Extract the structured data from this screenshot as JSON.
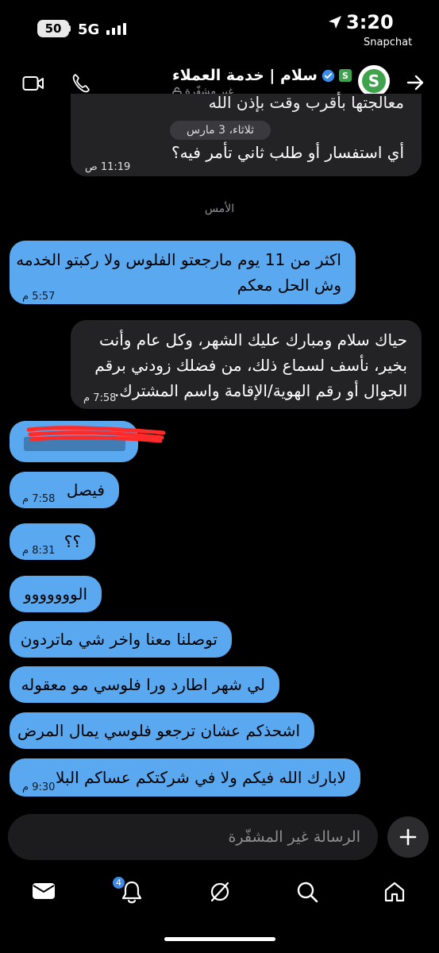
{
  "status_bar": {
    "battery": "50",
    "network": "5G",
    "time": "3:20",
    "back_app": "Snapchat"
  },
  "header": {
    "title": "سلام | خدمة العملاء",
    "subtitle": "غير مشفّرة",
    "avatar_letter": "S",
    "logo_letter": "S"
  },
  "messages": {
    "m1": {
      "partial_text": "معالجتها بأقرب وقت بإذن الله",
      "text": "أي استفسار أو طلب ثاني تأمر فيه؟",
      "time": "11:19 ص"
    },
    "date_pill": "ثلاثاء، 3 مارس",
    "day_separator": "الأمس",
    "m2": {
      "line1": "اكثر من 11 يوم مارجعتو الفلوس ولا ركبتو الخدمه",
      "line2": "وش الحل معكم",
      "time": "5:57 م"
    },
    "m3": {
      "line1": "حياك سلام ومبارك عليك الشهر، وكل عام وأنت",
      "line2": "بخير، نأسف لسماع ذلك، من فضلك زودني برقم",
      "line3": "الجوال أو رقم الهوية/الإقامة واسم المشترك.",
      "time": "7:58 م"
    },
    "m5": {
      "text": "فيصل",
      "time": "7:58 م"
    },
    "m6": {
      "text": "؟؟",
      "time": "8:31 م"
    },
    "m7": {
      "text": "الووووووو"
    },
    "m8": {
      "text": "توصلنا معنا واخر شي ماتردون"
    },
    "m9": {
      "text": "لي شهر اطارد ورا فلوسي مو معقوله"
    },
    "m10": {
      "text": "اشحذكم عشان ترجعو فلوسي يمال المرض"
    },
    "m11": {
      "text": "لابارك الله فيكم ولا في شركتكم عساكم البلا",
      "time": "9:30 م"
    }
  },
  "composer": {
    "placeholder": "الرسالة غير المشفّرة"
  },
  "nav": {
    "notifications_badge": "4"
  },
  "colors": {
    "background": "#000000",
    "sent_bubble": "#5aa9f0",
    "received_bubble": "#232326",
    "brand_green": "#3fa34d",
    "verified_blue": "#3c8be6"
  }
}
